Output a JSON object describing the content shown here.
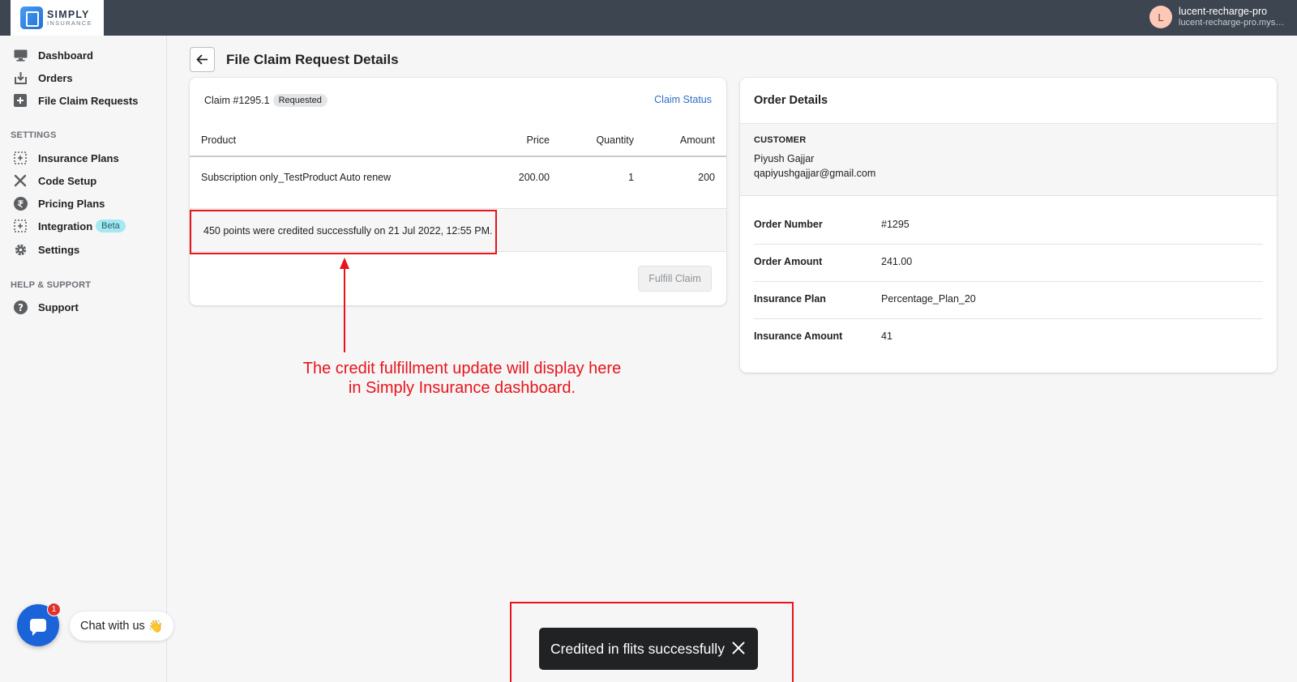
{
  "brand": {
    "line1": "SIMPLY",
    "line2": "INSURANCE"
  },
  "account": {
    "initial": "L",
    "name": "lucent-recharge-pro",
    "domain": "lucent-recharge-pro.myshopify.com"
  },
  "sidebar": {
    "main": [
      {
        "label": "Dashboard",
        "icon": "monitor-icon"
      },
      {
        "label": "Orders",
        "icon": "download-icon"
      },
      {
        "label": "File Claim Requests",
        "icon": "plus-square-icon"
      }
    ],
    "settings_title": "SETTINGS",
    "settings": [
      {
        "label": "Insurance Plans",
        "icon": "dashed-plus-icon"
      },
      {
        "label": "Code Setup",
        "icon": "tools-icon"
      },
      {
        "label": "Pricing Plans",
        "icon": "rupee-icon"
      },
      {
        "label": "Integration",
        "icon": "dashed-plus-icon",
        "badge": "Beta"
      },
      {
        "label": "Settings",
        "icon": "gear-icon"
      }
    ],
    "help_title": "HELP & SUPPORT",
    "help": [
      {
        "label": "Support",
        "icon": "question-icon"
      }
    ]
  },
  "chat": {
    "count": "1",
    "label": "Chat with us",
    "emoji": "👋"
  },
  "page": {
    "title": "File Claim Request Details"
  },
  "claim": {
    "title": "Claim #1295.1",
    "status_badge": "Requested",
    "status_link": "Claim Status",
    "columns": {
      "product": "Product",
      "price": "Price",
      "quantity": "Quantity",
      "amount": "Amount"
    },
    "row": {
      "product": "Subscription only_TestProduct Auto renew",
      "price": "200.00",
      "quantity": "1",
      "amount": "200"
    },
    "credit_message": "450 points were credited successfully on 21 Jul 2022, 12:55 PM.",
    "fulfill_label": "Fulfill Claim"
  },
  "order": {
    "title": "Order Details",
    "customer_label": "CUSTOMER",
    "customer_name": "Piyush Gajjar",
    "customer_email": "qapiyushgajjar@gmail.com",
    "rows": [
      {
        "key": "Order Number",
        "value": "#1295"
      },
      {
        "key": "Order Amount",
        "value": "241.00"
      },
      {
        "key": "Insurance Plan",
        "value": "Percentage_Plan_20"
      },
      {
        "key": "Insurance Amount",
        "value": "41"
      }
    ]
  },
  "annotation": {
    "line1": "The credit fulfillment update will display here",
    "line2": "in Simply Insurance dashboard.",
    "color": "#e8141a"
  },
  "toast": {
    "message": "Credited in flits successfully"
  }
}
